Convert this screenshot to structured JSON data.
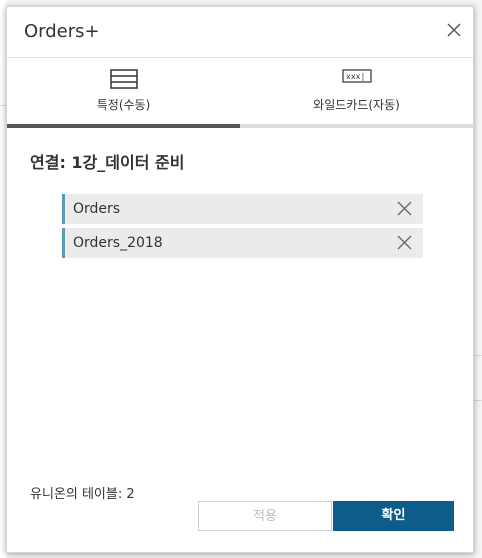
{
  "dialog": {
    "title": "Orders+"
  },
  "tabs": [
    {
      "label": "특정(수동)",
      "icon": "table-rows-icon",
      "active": true
    },
    {
      "label": "와일드카드(자동)",
      "icon": "wildcard-icon",
      "active": false
    }
  ],
  "tab_icons": {
    "wildcard_text": "xxx|"
  },
  "connection": {
    "title": "연결: 1강_데이터 준비"
  },
  "tables": [
    {
      "label": "Orders"
    },
    {
      "label": "Orders_2018"
    }
  ],
  "footer": {
    "union_count": "유니온의 테이블: 2",
    "apply_label": "적용",
    "ok_label": "확인"
  },
  "colors": {
    "accent": "#0e5c8a",
    "item_border": "#5b9bb5",
    "active_tab_bar": "#555555"
  }
}
